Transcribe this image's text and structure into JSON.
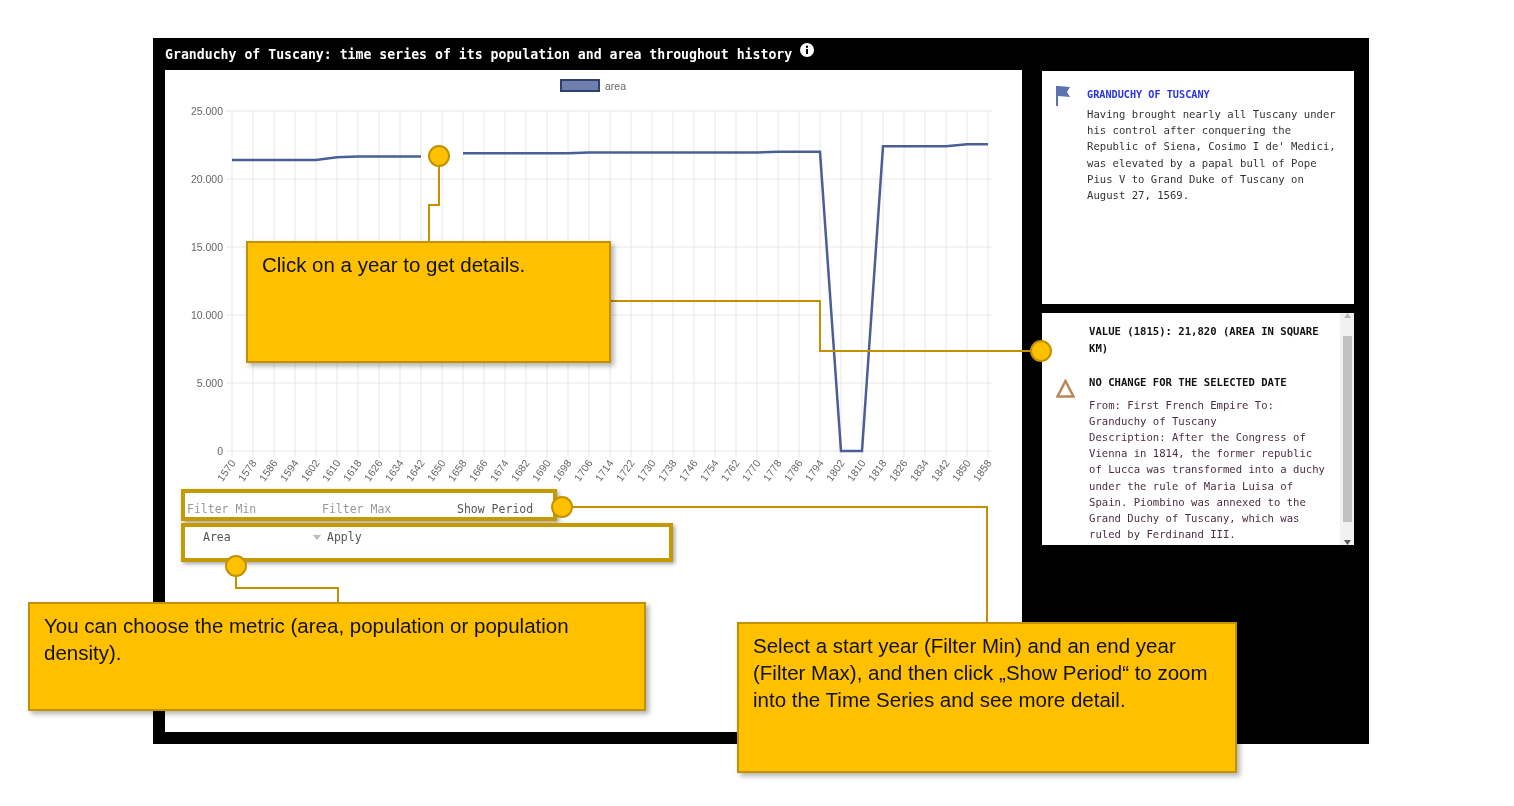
{
  "title": "Granduchy of Tuscany: time series of its population and area throughout history",
  "chart": {
    "chart_data": {
      "type": "line",
      "categories": [
        "1570",
        "1578",
        "1586",
        "1594",
        "1602",
        "1610",
        "1618",
        "1626",
        "1634",
        "1642",
        "1650",
        "1658",
        "1666",
        "1674",
        "1682",
        "1690",
        "1698",
        "1706",
        "1714",
        "1722",
        "1730",
        "1738",
        "1746",
        "1754",
        "1762",
        "1770",
        "1778",
        "1786",
        "1794",
        "1802",
        "1810",
        "1818",
        "1826",
        "1834",
        "1842",
        "1850",
        "1858"
      ],
      "series": [
        {
          "name": "area",
          "color": "#4a5f96",
          "values": [
            21400,
            21400,
            21400,
            21400,
            21400,
            21600,
            21650,
            21650,
            21650,
            21650,
            null,
            21900,
            21900,
            21900,
            21900,
            21900,
            21900,
            21950,
            21950,
            21950,
            21950,
            21950,
            21950,
            21950,
            21950,
            21950,
            22000,
            22000,
            22000,
            0,
            0,
            22400,
            22400,
            22400,
            22400,
            22550,
            22550
          ]
        }
      ],
      "ylim": [
        0,
        25000
      ],
      "grid": true,
      "yticks": [
        {
          "value": 0,
          "label": "0"
        },
        {
          "value": 5000,
          "label": "5.000"
        },
        {
          "value": 10000,
          "label": "10.000"
        },
        {
          "value": 15000,
          "label": "15.000"
        },
        {
          "value": 20000,
          "label": "20.000"
        },
        {
          "value": 25000,
          "label": "25.000"
        }
      ]
    }
  },
  "filters": {
    "min": {
      "placeholder": "Filter Min"
    },
    "max": {
      "placeholder": "Filter Max"
    },
    "show_button": "Show Period",
    "metric": {
      "value": "Area"
    },
    "apply_button": "Apply"
  },
  "info_panel": {
    "title": "GRANDUCHY OF TUSCANY",
    "text": "Having brought nearly all Tuscany under his control after conquering the Republic of Siena, Cosimo I de' Medici, was elevated by a papal bull of Pope Pius V to Grand Duke of Tuscany on August 27, 1569."
  },
  "detail_panel": {
    "value": "VALUE (1815): 21,820 (AREA IN SQUARE KM)",
    "status": "NO CHANGE FOR THE SELECTED DATE",
    "paragraphs": [
      "From: First French Empire To: Granduchy of Tuscany",
      "Description: After the Congress of Vienna in 1814, the former republic of Lucca was transformed into a duchy under the rule of Maria Luisa of Spain. Piombino was annexed to the Grand Duchy of Tuscany, which was ruled by Ferdinand III."
    ]
  },
  "callouts": [
    {
      "text": "Click on a year to get details."
    },
    {
      "text": "You can choose the metric (area, population or population density)."
    },
    {
      "text": "Select a start year (Filter Min) and an end year (Filter Max), and then click „Show Period“ to zoom into the Time Series and see more detail."
    }
  ]
}
